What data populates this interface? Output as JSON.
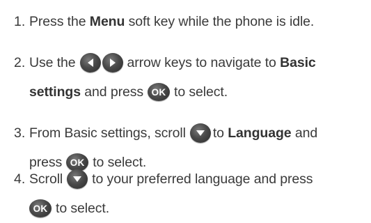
{
  "steps": [
    {
      "number": "1.",
      "lines": [
        {
          "t1": "Press the ",
          "b1": "Menu",
          "t2": " soft key while the phone is idle."
        }
      ]
    },
    {
      "number": "2.",
      "lines": [
        {
          "t1": "Use the",
          "t2": "arrow keys to navigate to ",
          "b1": "Basic"
        },
        {
          "b1": "settings",
          "t1": " and press",
          "t2": "to select."
        }
      ]
    },
    {
      "number": "3.",
      "lines": [
        {
          "t1": "From Basic settings, scroll",
          "t2": "to ",
          "b1": "Language",
          "t3": " and"
        },
        {
          "t1": "press",
          "t2": "to select."
        }
      ]
    },
    {
      "number": "4.",
      "lines": [
        {
          "t1": "Scroll",
          "t2": "to your preferred language and press"
        },
        {
          "t1": "to select."
        }
      ]
    }
  ],
  "icons": {
    "ok_label": "OK",
    "left_arrow": "left-arrow-key-icon",
    "right_arrow": "right-arrow-key-icon",
    "down_arrow": "down-arrow-key-icon",
    "ok": "ok-key-icon"
  },
  "colors": {
    "text": "#3a3a3a",
    "key_fill": "#4a4a4a"
  }
}
